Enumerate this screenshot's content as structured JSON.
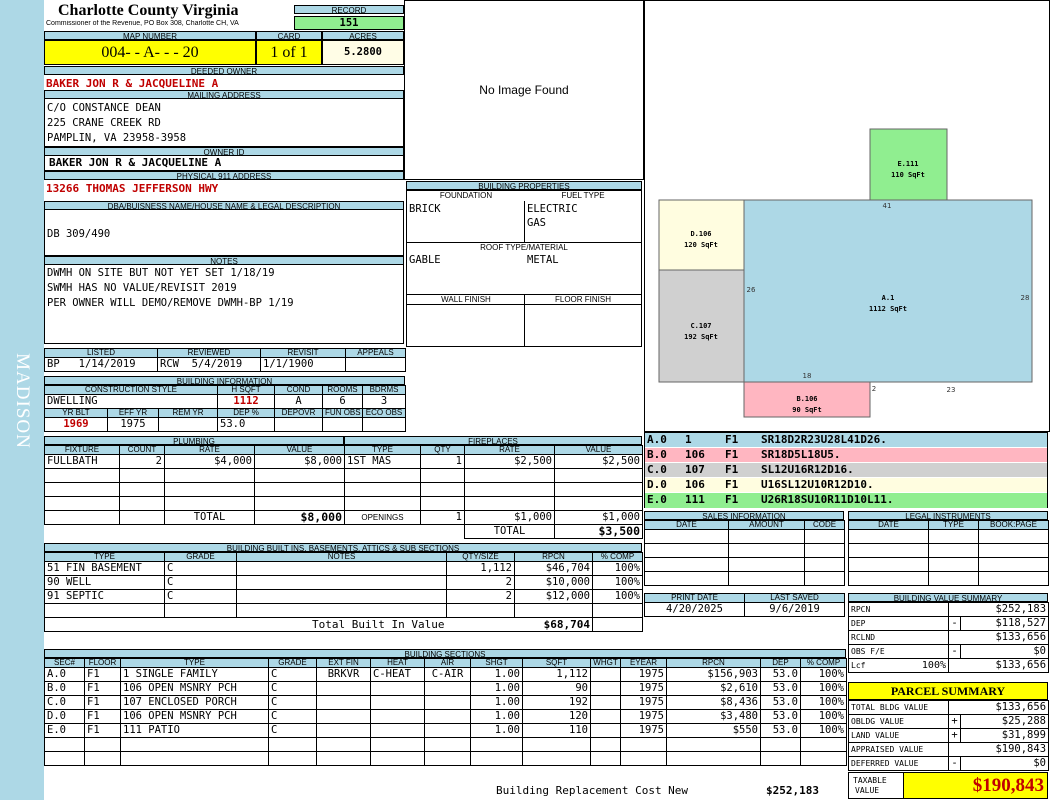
{
  "county": {
    "title": "Charlotte County Virginia",
    "subtitle": "Commissioner of the Revenue, PO Box 308, Charlotte CH, VA"
  },
  "district": "MADISON",
  "record": {
    "label": "RECORD",
    "value": "151"
  },
  "map": {
    "label": "MAP NUMBER",
    "value": "004- - A- - - 20"
  },
  "card": {
    "label": "CARD",
    "value": "1 of 1"
  },
  "acres": {
    "label": "ACRES",
    "value": "5.2800"
  },
  "deeded_owner": {
    "label": "DEEDED OWNER",
    "value": "BAKER JON R & JACQUELINE A"
  },
  "mailing": {
    "label": "MAILING ADDRESS",
    "lines": [
      "C/O CONSTANCE DEAN",
      "225 CRANE CREEK RD",
      "PAMPLIN, VA 23958-3958"
    ]
  },
  "owner_id": {
    "label": "OWNER ID",
    "value": "BAKER JON R & JACQUELINE A"
  },
  "physical": {
    "label": "PHYSICAL 911 ADDRESS",
    "value": "13266 THOMAS JEFFERSON HWY"
  },
  "dba": {
    "label": "DBA/BUISNESS NAME/HOUSE NAME & LEGAL DESCRIPTION",
    "value": "DB 309/490"
  },
  "notes": {
    "label": "NOTES",
    "lines": [
      "DWMH ON SITE BUT NOT YET SET 1/18/19",
      "SWMH HAS NO VALUE/REVISIT 2019",
      "PER OWNER WILL DEMO/REMOVE DWMH-BP 1/19"
    ]
  },
  "image": {
    "placeholder": "No Image Found"
  },
  "building_properties": {
    "label": "BUILDING PROPERTIES",
    "foundation_label": "FOUNDATION",
    "fuel_label": "FUEL TYPE",
    "foundation": "BRICK",
    "fuel_1": "ELECTRIC",
    "fuel_2": "GAS",
    "roof_label": "ROOF TYPE/MATERIAL",
    "roof_type": "GABLE",
    "roof_material": "METAL",
    "wall_label": "WALL FINISH",
    "floor_label": "FLOOR FINISH"
  },
  "review": {
    "listed_label": "LISTED",
    "reviewed_label": "REVIEWED",
    "revisit_label": "REVISIT",
    "appeals_label": "APPEALS",
    "listed_by": "BP",
    "listed_date": "1/14/2019",
    "reviewed_by": "RCW",
    "reviewed_date": "5/4/2019",
    "revisit": "1/1/1900"
  },
  "building_info": {
    "label": "BUILDING INFORMATION",
    "h_style": "CONSTRUCTION STYLE",
    "h_sqft": "H SQFT",
    "h_cond": "COND",
    "h_rooms": "ROOMS",
    "h_bdrms": "BDRMS",
    "style": "DWELLING",
    "sqft": "1112",
    "cond": "A",
    "rooms": "6",
    "bdrms": "3",
    "h_yrblt": "YR BLT",
    "h_effyr": "EFF YR",
    "h_remyr": "REM YR",
    "h_dep": "DEP %",
    "h_depovr": "DEPOVR",
    "h_funobs": "FUN OBS",
    "h_ecoobs": "ECO OBS",
    "yrblt": "1969",
    "effyr": "1975",
    "dep": "53.0"
  },
  "plumbing": {
    "label": "PLUMBING",
    "headers": [
      "FIXTURE",
      "COUNT",
      "RATE",
      "VALUE"
    ],
    "rows": [
      [
        "FULLBATH",
        "2",
        "$4,000",
        "$8,000"
      ]
    ],
    "total_label": "TOTAL",
    "total": "$8,000"
  },
  "fireplaces": {
    "label": "FIREPLACES",
    "headers": [
      "TYPE",
      "QTY",
      "RATE",
      "VALUE"
    ],
    "rows": [
      [
        "1ST MAS",
        "1",
        "$2,500",
        "$2,500"
      ]
    ],
    "openings_label": "OPENINGS",
    "openings": [
      "1",
      "$1,000",
      "$1,000"
    ],
    "total_label": "TOTAL",
    "total": "$3,500"
  },
  "built_ins": {
    "label": "BUILDING BUILT INS, BASEMENTS, ATTICS & SUB SECTIONS",
    "headers": [
      "TYPE",
      "GRADE",
      "NOTES",
      "QTY/SIZE",
      "RPCN",
      "% COMP"
    ],
    "rows": [
      [
        "51 FIN BASEMENT",
        "C",
        "",
        "1,112",
        "$46,704",
        "100%"
      ],
      [
        "90 WELL",
        "C",
        "",
        "2",
        "$10,000",
        "100%"
      ],
      [
        "91 SEPTIC",
        "C",
        "",
        "2",
        "$12,000",
        "100%"
      ]
    ],
    "total_label": "Total Built In Value",
    "total": "$68,704"
  },
  "sections": {
    "label": "BUILDING SECTIONS",
    "headers": [
      "SEC#",
      "FLOOR",
      "TYPE",
      "GRADE",
      "EXT FIN",
      "HEAT",
      "AIR",
      "SHGT",
      "SQFT",
      "WHGT",
      "EYEAR",
      "RPCN",
      "DEP",
      "% COMP"
    ],
    "rows": [
      [
        "A.0",
        "F1",
        "1 SINGLE FAMILY",
        "C",
        "BRKVR",
        "C-HEAT",
        "C-AIR",
        "1.00",
        "1,112",
        "",
        "1975",
        "$156,903",
        "53.0",
        "100%"
      ],
      [
        "B.0",
        "F1",
        "106 OPEN MSNRY PCH",
        "C",
        "",
        "",
        "",
        "1.00",
        "90",
        "",
        "1975",
        "$2,610",
        "53.0",
        "100%"
      ],
      [
        "C.0",
        "F1",
        "107 ENCLOSED PORCH",
        "C",
        "",
        "",
        "",
        "1.00",
        "192",
        "",
        "1975",
        "$8,436",
        "53.0",
        "100%"
      ],
      [
        "D.0",
        "F1",
        "106 OPEN MSNRY PCH",
        "C",
        "",
        "",
        "",
        "1.00",
        "120",
        "",
        "1975",
        "$3,480",
        "53.0",
        "100%"
      ],
      [
        "E.0",
        "F1",
        "111 PATIO",
        "C",
        "",
        "",
        "",
        "1.00",
        "110",
        "",
        "1975",
        "$550",
        "53.0",
        "100%"
      ]
    ],
    "rcn_label": "Building Replacement Cost New",
    "rcn": "$252,183"
  },
  "sketch": {
    "labels": [
      {
        "id": "E.111",
        "area": "110 SqFt",
        "color": "#90ee90"
      },
      {
        "id": "D.106",
        "area": "120 SqFt",
        "color": "#fffde0"
      },
      {
        "id": "A.1",
        "area": "1112 SqFt",
        "color": "#add8e6"
      },
      {
        "id": "C.107",
        "area": "192 SqFt",
        "color": "#d0d0d0"
      },
      {
        "id": "B.106",
        "area": "90 SqFt",
        "color": "#ffb6c1"
      }
    ],
    "dims": [
      "41",
      "26",
      "28",
      "18",
      "2",
      "23"
    ]
  },
  "sketch_legend": [
    {
      "sec": "A.0",
      "num": "1",
      "floor": "F1",
      "code": "SR18D2R23U28L41D26.",
      "color": "#add8e6"
    },
    {
      "sec": "B.0",
      "num": "106",
      "floor": "F1",
      "code": "SR18D5L18U5.",
      "color": "#ffb6c1"
    },
    {
      "sec": "C.0",
      "num": "107",
      "floor": "F1",
      "code": "SL12U16R12D16.",
      "color": "#d0d0d0"
    },
    {
      "sec": "D.0",
      "num": "106",
      "floor": "F1",
      "code": "U16SL12U10R12D10.",
      "color": "#fffde0"
    },
    {
      "sec": "E.0",
      "num": "111",
      "floor": "F1",
      "code": "U26R18SU10R11D10L11.",
      "color": "#90ee90"
    }
  ],
  "sales": {
    "label": "SALES INFORMATION",
    "headers": [
      "DATE",
      "AMOUNT",
      "CODE"
    ]
  },
  "legal": {
    "label": "LEGAL INSTRUMENTS",
    "headers": [
      "DATE",
      "TYPE",
      "BOOK:PAGE"
    ]
  },
  "print": {
    "print_label": "PRINT DATE",
    "saved_label": "LAST SAVED",
    "print_date": "4/20/2025",
    "saved_date": "9/6/2019"
  },
  "value_summary": {
    "label": "BUILDING VALUE SUMMARY",
    "rows": [
      {
        "label": "RPCN",
        "sign": "",
        "value": "$252,183"
      },
      {
        "label": "DEP",
        "sign": "-",
        "value": "$118,527"
      },
      {
        "label": "RCLND",
        "sign": "",
        "value": "$133,656"
      },
      {
        "label": "OBS F/E",
        "sign": "-",
        "value": "$0"
      },
      {
        "label": "Lcf",
        "pct": "100%",
        "sign": "",
        "value": "$133,656"
      }
    ]
  },
  "parcel_summary": {
    "label": "PARCEL SUMMARY",
    "rows": [
      {
        "label": "TOTAL BLDG VALUE",
        "sign": "",
        "value": "$133,656"
      },
      {
        "label": "OBLDG VALUE",
        "sign": "+",
        "value": "$25,288"
      },
      {
        "label": "LAND VALUE",
        "sign": "+",
        "value": "$31,899"
      },
      {
        "label": "APPRAISED VALUE",
        "sign": "",
        "value": "$190,843"
      },
      {
        "label": "DEFERRED VALUE",
        "sign": "-",
        "value": "$0"
      }
    ],
    "taxable_label_1": "TAXABLE",
    "taxable_label_2": "VALUE",
    "taxable": "$190,843"
  },
  "colors": {
    "header_bg": "#add8e6",
    "highlight": "#ffff00",
    "record_bg": "#90ee90",
    "value_red": "#c00000"
  }
}
